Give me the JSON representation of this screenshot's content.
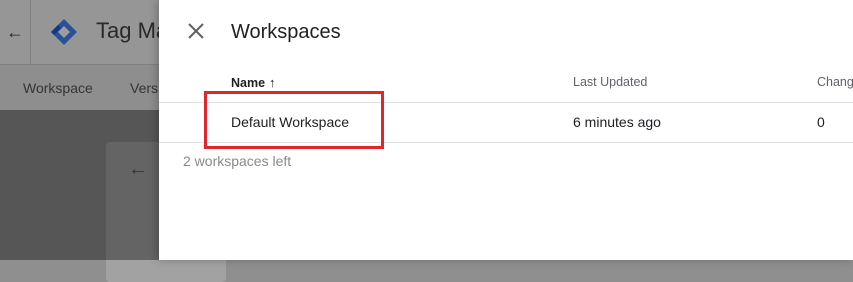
{
  "background": {
    "back_icon": "arrow-left-icon",
    "logo_icon": "tag-manager-logo-icon",
    "app_title": "Tag Ma",
    "tabs": [
      "Workspace",
      "Vers"
    ],
    "card_back_icon": "arrow-left-icon"
  },
  "panel": {
    "close_icon": "close-icon",
    "title": "Workspaces",
    "columns": {
      "name": "Name",
      "name_sort_icon": "arrow-up-icon",
      "last_updated": "Last Updated",
      "changes": "Chang"
    },
    "rows": [
      {
        "name": "Default Workspace",
        "last_updated": "6 minutes ago",
        "changes": "0"
      }
    ],
    "footer": "2 workspaces left"
  },
  "colors": {
    "highlight": "#e0262a",
    "logo_blue": "#4285f4",
    "text": "#202124",
    "muted": "#5f6368"
  }
}
